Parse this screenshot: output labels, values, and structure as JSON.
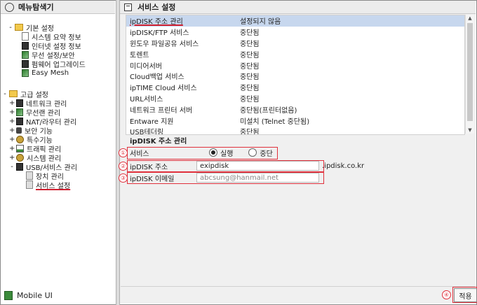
{
  "left_panel": {
    "title": "메뉴탐색기",
    "tree": [
      {
        "label": "기본 설정",
        "toggle": "-",
        "level": 0,
        "icon": "gear-folder-icon"
      },
      {
        "label": "시스템 요약 정보",
        "level": 1,
        "icon": "page-icon"
      },
      {
        "label": "인터넷 설정 정보",
        "level": 1,
        "icon": "page-icon"
      },
      {
        "label": "무선 설정/보안",
        "level": 1,
        "icon": "wifi-icon"
      },
      {
        "label": "펌웨어 업그레이드",
        "level": 1,
        "icon": "page-icon"
      },
      {
        "label": "Easy Mesh",
        "level": 1,
        "icon": "wifi-icon"
      },
      {
        "label": "고급 설정",
        "toggle": "-",
        "level": 0,
        "icon": "gear-folder-icon"
      },
      {
        "label": "네트워크 관리",
        "toggle": "+",
        "level": 1,
        "icon": "network-icon"
      },
      {
        "label": "무선랜 관리",
        "toggle": "+",
        "level": 1,
        "icon": "wifi-icon"
      },
      {
        "label": "NAT/라우터 관리",
        "toggle": "+",
        "level": 1,
        "icon": "router-icon"
      },
      {
        "label": "보안 기능",
        "toggle": "+",
        "level": 1,
        "icon": "lock-icon"
      },
      {
        "label": "특수기능",
        "toggle": "+",
        "level": 1,
        "icon": "gear-icon"
      },
      {
        "label": "트래픽 관리",
        "toggle": "+",
        "level": 1,
        "icon": "chart-icon"
      },
      {
        "label": "시스템 관리",
        "toggle": "+",
        "level": 1,
        "icon": "gear-icon"
      },
      {
        "label": "USB/서비스 관리",
        "toggle": "-",
        "level": 1,
        "icon": "usb-icon"
      },
      {
        "label": "장치 관리",
        "level": 2,
        "icon": "page-icon"
      },
      {
        "label": "서비스 설정",
        "level": 2,
        "icon": "page-icon",
        "selected": true
      }
    ],
    "mobile_ui": "Mobile UI"
  },
  "right_panel": {
    "title": "서비스 설정",
    "services": [
      {
        "name": "ipDISK 주소 관리",
        "status": "설정되지 않음",
        "selected": true
      },
      {
        "name": "ipDISK/FTP 서비스",
        "status": "중단됨"
      },
      {
        "name": "윈도우 파일공유 서비스",
        "status": "중단됨"
      },
      {
        "name": "토렌트",
        "status": "중단됨"
      },
      {
        "name": "미디어서버",
        "status": "중단됨"
      },
      {
        "name": "Cloud백업 서비스",
        "status": "중단됨"
      },
      {
        "name": "ipTIME Cloud 서비스",
        "status": "중단됨"
      },
      {
        "name": "URL서비스",
        "status": "중단됨"
      },
      {
        "name": "네트워크 프린터 서버",
        "status": "중단됨(프린터없음)"
      },
      {
        "name": "Entware 지원",
        "status": "미설치 (Telnet 중단됨)"
      },
      {
        "name": "USB테더링",
        "status": "중단됨"
      }
    ],
    "section_title": "ipDISK 주소 관리",
    "form": {
      "service_label": "서비스",
      "run_label": "실행",
      "stop_label": "중단",
      "address_label": "ipDISK 주소",
      "address_value": "exipdisk",
      "domain_suffix": ".ipdisk.co.kr",
      "email_label": "ipDISK 이메일",
      "email_value": "abcsung@hanmail.net"
    },
    "markers": [
      "①",
      "②",
      "③",
      "④"
    ],
    "apply_label": "적용"
  },
  "colors": {
    "highlight": "#e0303c",
    "selected_row": "#c7d7ee"
  }
}
